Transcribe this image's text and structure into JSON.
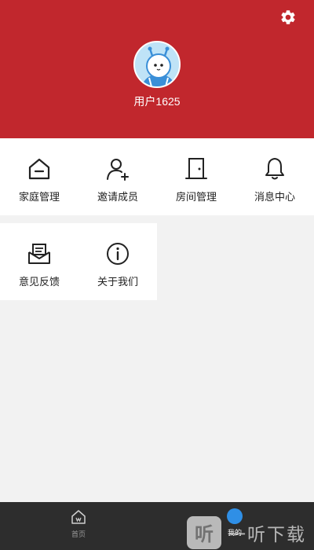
{
  "header": {
    "username": "用户1625",
    "background": "#c1272d",
    "settings_icon": "gear-icon",
    "avatar_icon": "cartoon-avatar"
  },
  "menu": {
    "row1": [
      {
        "label": "家庭管理",
        "icon": "home-icon"
      },
      {
        "label": "邀请成员",
        "icon": "add-user-icon"
      },
      {
        "label": "房间管理",
        "icon": "door-icon"
      },
      {
        "label": "消息中心",
        "icon": "bell-icon"
      }
    ],
    "row2": [
      {
        "label": "意见反馈",
        "icon": "feedback-envelope-icon"
      },
      {
        "label": "关于我们",
        "icon": "info-icon"
      }
    ]
  },
  "tabbar": {
    "home_label": "首页",
    "mine_label": "我的",
    "active_tab": "我的",
    "active_color": "#2f8fe6"
  },
  "watermark": {
    "logo_char": "听",
    "text": "一听下载"
  }
}
